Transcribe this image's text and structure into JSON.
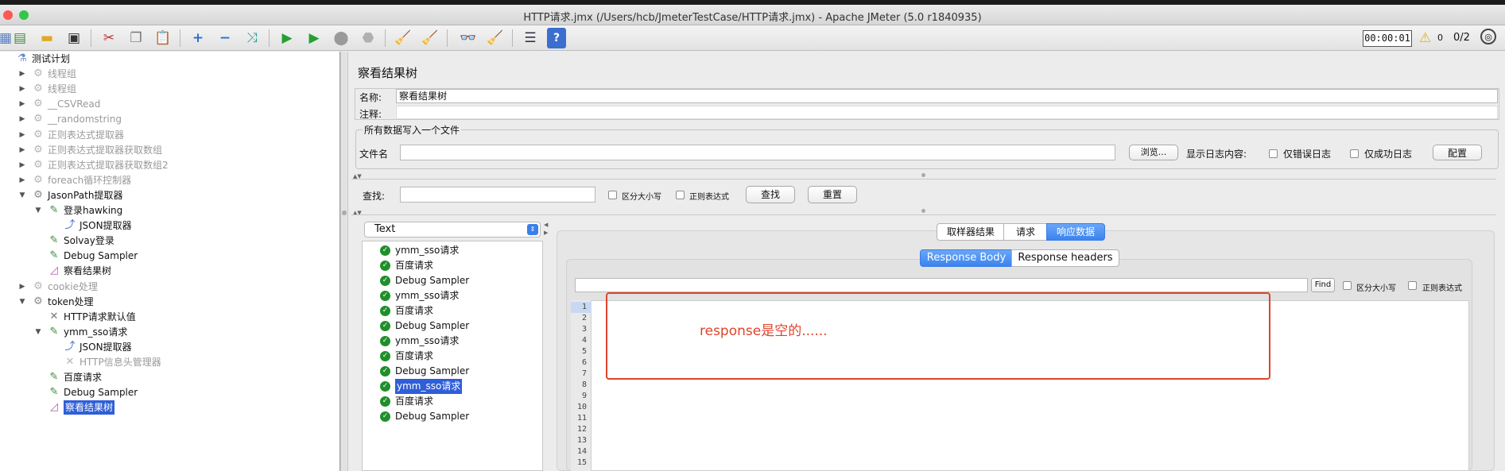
{
  "window": {
    "title": "HTTP请求.jmx (/Users/hcb/JmeterTestCase/HTTP请求.jmx) - Apache JMeter (5.0 r1840935)",
    "colors": {
      "close": "#fc5753",
      "minimize": "#fdbc40",
      "zoom": "#33c748"
    }
  },
  "toolbar": {
    "timer": "00:00:01",
    "warning_count": "0",
    "threads": "0/2"
  },
  "tree": {
    "items": [
      {
        "label": "测试计划",
        "level": 0,
        "icon": "test-plan-icon",
        "expand": "",
        "disabled": false,
        "selected": false
      },
      {
        "label": "线程组",
        "level": 1,
        "icon": "gear-icon",
        "expand": "▶",
        "disabled": true,
        "selected": false
      },
      {
        "label": "线程组",
        "level": 1,
        "icon": "gear-icon",
        "expand": "▶",
        "disabled": true,
        "selected": false
      },
      {
        "label": "__CSVRead",
        "level": 1,
        "icon": "gear-icon",
        "expand": "▶",
        "disabled": true,
        "selected": false
      },
      {
        "label": "__randomstring",
        "level": 1,
        "icon": "gear-icon",
        "expand": "▶",
        "disabled": true,
        "selected": false
      },
      {
        "label": "正则表达式提取器",
        "level": 1,
        "icon": "gear-icon",
        "expand": "▶",
        "disabled": true,
        "selected": false
      },
      {
        "label": "正则表达式提取器获取数组",
        "level": 1,
        "icon": "gear-icon",
        "expand": "▶",
        "disabled": true,
        "selected": false
      },
      {
        "label": "正则表达式提取器获取数组2",
        "level": 1,
        "icon": "gear-icon",
        "expand": "▶",
        "disabled": true,
        "selected": false
      },
      {
        "label": "foreach循环控制器",
        "level": 1,
        "icon": "gear-icon",
        "expand": "▶",
        "disabled": true,
        "selected": false
      },
      {
        "label": "JasonPath提取器",
        "level": 1,
        "icon": "gear-icon",
        "expand": "▼",
        "disabled": false,
        "selected": false
      },
      {
        "label": "登录hawking",
        "level": 2,
        "icon": "sampler-icon",
        "expand": "▼",
        "disabled": false,
        "selected": false
      },
      {
        "label": "JSON提取器",
        "level": 3,
        "icon": "extractor-icon",
        "expand": "",
        "disabled": false,
        "selected": false
      },
      {
        "label": "Solvay登录",
        "level": 2,
        "icon": "sampler-icon",
        "expand": "",
        "disabled": false,
        "selected": false
      },
      {
        "label": "Debug Sampler",
        "level": 2,
        "icon": "sampler-icon",
        "expand": "",
        "disabled": false,
        "selected": false
      },
      {
        "label": "察看结果树",
        "level": 2,
        "icon": "listener-icon",
        "expand": "",
        "disabled": false,
        "selected": false
      },
      {
        "label": "cookie处理",
        "level": 1,
        "icon": "gear-icon",
        "expand": "▶",
        "disabled": true,
        "selected": false
      },
      {
        "label": "token处理",
        "level": 1,
        "icon": "gear-icon",
        "expand": "▼",
        "disabled": false,
        "selected": false
      },
      {
        "label": "HTTP请求默认值",
        "level": 2,
        "icon": "config-icon",
        "expand": "",
        "disabled": false,
        "selected": false
      },
      {
        "label": "ymm_sso请求",
        "level": 2,
        "icon": "sampler-icon",
        "expand": "▼",
        "disabled": false,
        "selected": false
      },
      {
        "label": "JSON提取器",
        "level": 3,
        "icon": "extractor-icon",
        "expand": "",
        "disabled": false,
        "selected": false
      },
      {
        "label": "HTTP信息头管理器",
        "level": 3,
        "icon": "config-icon",
        "expand": "",
        "disabled": true,
        "selected": false
      },
      {
        "label": "百度请求",
        "level": 2,
        "icon": "sampler-icon",
        "expand": "",
        "disabled": false,
        "selected": false
      },
      {
        "label": "Debug Sampler",
        "level": 2,
        "icon": "sampler-icon",
        "expand": "",
        "disabled": false,
        "selected": false
      },
      {
        "label": "察看结果树",
        "level": 2,
        "icon": "listener-icon",
        "expand": "",
        "disabled": false,
        "selected": true
      }
    ]
  },
  "panel": {
    "title": "察看结果树",
    "name_label": "名称:",
    "name_value": "察看结果树",
    "comment_label": "注释:",
    "comment_value": "",
    "file_group_title": "所有数据写入一个文件",
    "file_label": "文件名",
    "file_value": "",
    "browse_label": "浏览...",
    "log_display_label": "显示日志内容:",
    "errors_only_label": "仅错误日志",
    "success_only_label": "仅成功日志",
    "configure_label": "配置",
    "search_label": "查找:",
    "search_value": "",
    "case_sensitive_label": "区分大小写",
    "regex_label": "正则表达式",
    "find_label": "查找",
    "reset_label": "重置"
  },
  "renderer": {
    "selected": "Text"
  },
  "results": [
    {
      "label": "ymm_sso请求",
      "selected": false
    },
    {
      "label": "百度请求",
      "selected": false
    },
    {
      "label": "Debug Sampler",
      "selected": false
    },
    {
      "label": "ymm_sso请求",
      "selected": false
    },
    {
      "label": "百度请求",
      "selected": false
    },
    {
      "label": "Debug Sampler",
      "selected": false
    },
    {
      "label": "ymm_sso请求",
      "selected": false
    },
    {
      "label": "百度请求",
      "selected": false
    },
    {
      "label": "Debug Sampler",
      "selected": false
    },
    {
      "label": "ymm_sso请求",
      "selected": true
    },
    {
      "label": "百度请求",
      "selected": false
    },
    {
      "label": "Debug Sampler",
      "selected": false
    }
  ],
  "result_tabs": [
    {
      "label": "取样器结果",
      "active": false
    },
    {
      "label": "请求",
      "active": false
    },
    {
      "label": "响应数据",
      "active": true
    }
  ],
  "response_tabs": [
    {
      "label": "Response Body",
      "active": true
    },
    {
      "label": "Response headers",
      "active": false
    }
  ],
  "inner_search": {
    "value": "",
    "find_label": "Find",
    "case_label": "区分大小写",
    "regex_label": "正则表达式"
  },
  "line_numbers": [
    "1",
    "2",
    "3",
    "4",
    "5",
    "6",
    "7",
    "8",
    "9",
    "10",
    "11",
    "12",
    "13",
    "14",
    "15"
  ],
  "annotation": {
    "text": "response是空的......",
    "color": "#e0442b"
  }
}
